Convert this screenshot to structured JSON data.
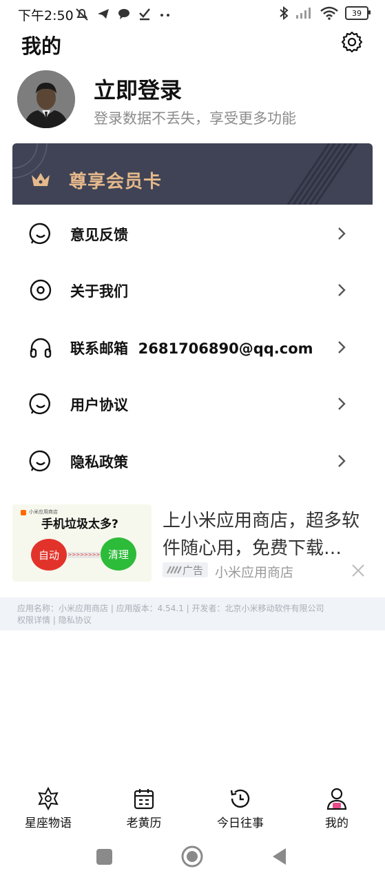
{
  "status_bar": {
    "time": "下午2:50",
    "battery": "39",
    "icons": [
      "mute-bell-icon",
      "telegram-icon",
      "chat-icon",
      "download-icon",
      "more-dots-icon",
      "bluetooth-icon",
      "signal-icon",
      "wifi-icon",
      "battery-icon"
    ]
  },
  "header": {
    "title": "我的",
    "settings_icon": "gear-icon"
  },
  "profile": {
    "title": "立即登录",
    "subtitle": "登录数据不丢失，享受更多功能"
  },
  "vip_card": {
    "label": "尊享会员卡",
    "color": "#3f4355",
    "accent": "#e6b98b"
  },
  "menu": [
    {
      "icon": "smile-icon",
      "label": "意见反馈"
    },
    {
      "icon": "target-icon",
      "label": "关于我们"
    },
    {
      "icon": "headphones-icon",
      "label": "联系邮箱  2681706890@qq.com"
    },
    {
      "icon": "smile-icon",
      "label": "用户协议"
    },
    {
      "icon": "smile-icon",
      "label": "隐私政策"
    }
  ],
  "ad": {
    "image_title": "手机垃圾太多?",
    "image_small": "小米应用商店",
    "btn_auto": "自动",
    "btn_clean": "清理",
    "arrows": ">>>>>>>>",
    "title": "上小米应用商店，超多软件随心用，免费下载…",
    "tag": "广告",
    "source": "小米应用商店",
    "info_line1": "应用名称：小米应用商店 | 应用版本：4.54.1 | 开发者：北京小米移动软件有限公司",
    "info_links": [
      "权限详情",
      "隐私协议"
    ],
    "info_sep": "|"
  },
  "tabbar": [
    {
      "icon": "star-icon",
      "label": "星座物语"
    },
    {
      "icon": "calendar-icon",
      "label": "老黄历"
    },
    {
      "icon": "history-clock-icon",
      "label": "今日往事"
    },
    {
      "icon": "user-icon",
      "label": "我的"
    }
  ]
}
